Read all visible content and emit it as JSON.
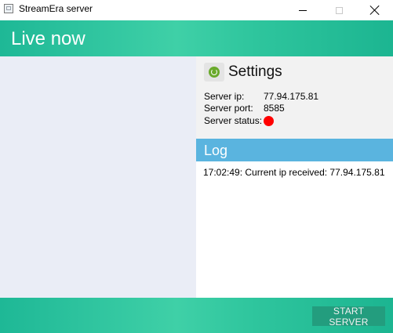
{
  "window": {
    "title": "StreamEra server"
  },
  "header": {
    "title": "Live now"
  },
  "settings": {
    "title": "Settings",
    "icon": "refresh-icon",
    "fields": [
      {
        "label": "Server ip:",
        "value": "77.94.175.81"
      },
      {
        "label": "Server port:",
        "value": "8585"
      },
      {
        "label": "Server status:",
        "status_color": "#ff0000"
      }
    ]
  },
  "log": {
    "title": "Log",
    "lines": [
      "17:02:49: Current ip received: 77.94.175.81"
    ]
  },
  "footer": {
    "start_label": "START SERVER"
  },
  "colors": {
    "accent": "#2ec59d",
    "log_header": "#5ab4df",
    "status": "#ff0000",
    "button": "#239d7e"
  }
}
